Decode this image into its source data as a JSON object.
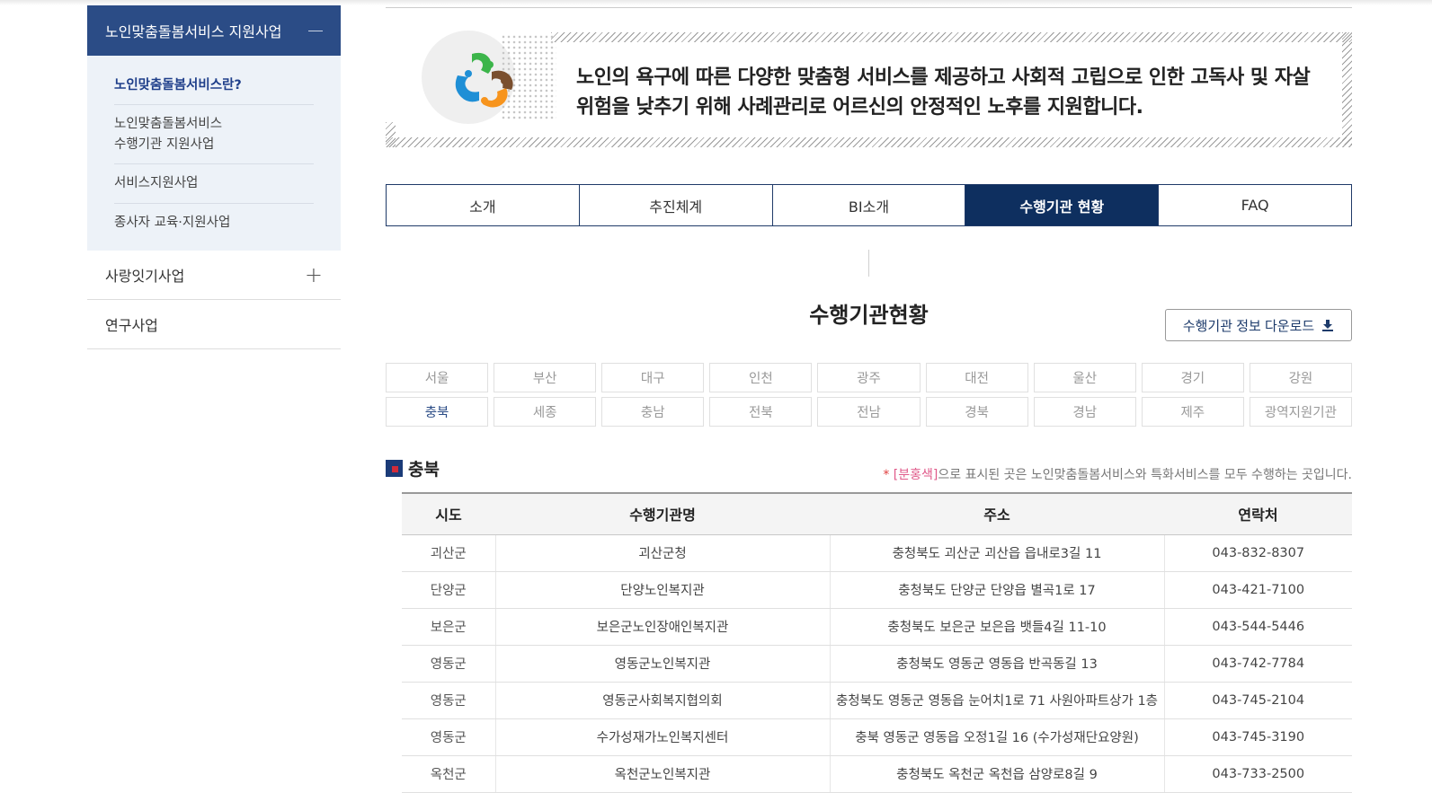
{
  "sidebar": {
    "header": "노인맞춤돌봄서비스 지원사업",
    "sub_items": [
      {
        "label": "노인맞춤돌봄서비스란?",
        "active": true
      },
      {
        "label": "노인맞춤돌봄서비스\n수행기관 지원사업",
        "active": false
      },
      {
        "label": "서비스지원사업",
        "active": false
      },
      {
        "label": "종사자 교육·지원사업",
        "active": false
      }
    ],
    "items": [
      {
        "label": "사랑잇기사업",
        "expand": "+"
      },
      {
        "label": "연구사업",
        "expand": ""
      }
    ]
  },
  "banner": {
    "text": "노인의 욕구에 따른 다양한 맞춤형 서비스를 제공하고 사회적 고립으로 인한 고독사 및 자살위험을 낮추기 위해 사례관리로 어르신의 안정적인 노후를 지원합니다.",
    "logo_colors": [
      "#1f8fd6",
      "#3cb54a",
      "#f7941d",
      "#7a4f2e"
    ]
  },
  "tabs": [
    {
      "label": "소개",
      "active": false
    },
    {
      "label": "추진체계",
      "active": false
    },
    {
      "label": "BI소개",
      "active": false
    },
    {
      "label": "수행기관 현황",
      "active": true
    },
    {
      "label": "FAQ",
      "active": false
    }
  ],
  "section": {
    "title": "수행기관현황",
    "download_label": "수행기관 정보 다운로드"
  },
  "regions": [
    {
      "label": "서울",
      "active": false
    },
    {
      "label": "부산",
      "active": false
    },
    {
      "label": "대구",
      "active": false
    },
    {
      "label": "인천",
      "active": false
    },
    {
      "label": "광주",
      "active": false
    },
    {
      "label": "대전",
      "active": false
    },
    {
      "label": "울산",
      "active": false
    },
    {
      "label": "경기",
      "active": false
    },
    {
      "label": "강원",
      "active": false
    },
    {
      "label": "충북",
      "active": true
    },
    {
      "label": "세종",
      "active": false
    },
    {
      "label": "충남",
      "active": false
    },
    {
      "label": "전북",
      "active": false
    },
    {
      "label": "전남",
      "active": false
    },
    {
      "label": "경북",
      "active": false
    },
    {
      "label": "경남",
      "active": false
    },
    {
      "label": "제주",
      "active": false
    },
    {
      "label": "광역지원기관",
      "active": false
    }
  ],
  "region_heading": "충북",
  "note": {
    "star": "*",
    "highlight": "[분홍색]",
    "rest": "으로 표시된 곳은 노인맞춤돌봄서비스와 특화서비스를 모두 수행하는 곳입니다."
  },
  "table": {
    "headers": [
      "시도",
      "수행기관명",
      "주소",
      "연락처"
    ],
    "rows": [
      [
        "괴산군",
        "괴산군청",
        "충청북도 괴산군 괴산읍 읍내로3길 11",
        "043-832-8307"
      ],
      [
        "단양군",
        "단양노인복지관",
        "충청북도 단양군 단양읍 별곡1로 17",
        "043-421-7100"
      ],
      [
        "보은군",
        "보은군노인장애인복지관",
        "충청북도 보은군 보은읍 뱃들4길 11-10",
        "043-544-5446"
      ],
      [
        "영동군",
        "영동군노인복지관",
        "충청북도 영동군 영동읍 반곡동길 13",
        "043-742-7784"
      ],
      [
        "영동군",
        "영동군사회복지협의회",
        "충청북도 영동군 영동읍 눈어치1로 71 사원아파트상가 1층",
        "043-745-2104"
      ],
      [
        "영동군",
        "수가성재가노인복지센터",
        "충북 영동군 영동읍 오정1길 16 (수가성재단요양원)",
        "043-745-3190"
      ],
      [
        "옥천군",
        "옥천군노인복지관",
        "충청북도 옥천군 옥천읍 삼양로8길 9",
        "043-733-2500"
      ]
    ]
  },
  "colors": {
    "sidebar_header": "#2b4c86",
    "sidebar_sub_bg": "#edf2f8",
    "tab_active": "#0e2f5f",
    "note_pink": "#e05a8a"
  }
}
